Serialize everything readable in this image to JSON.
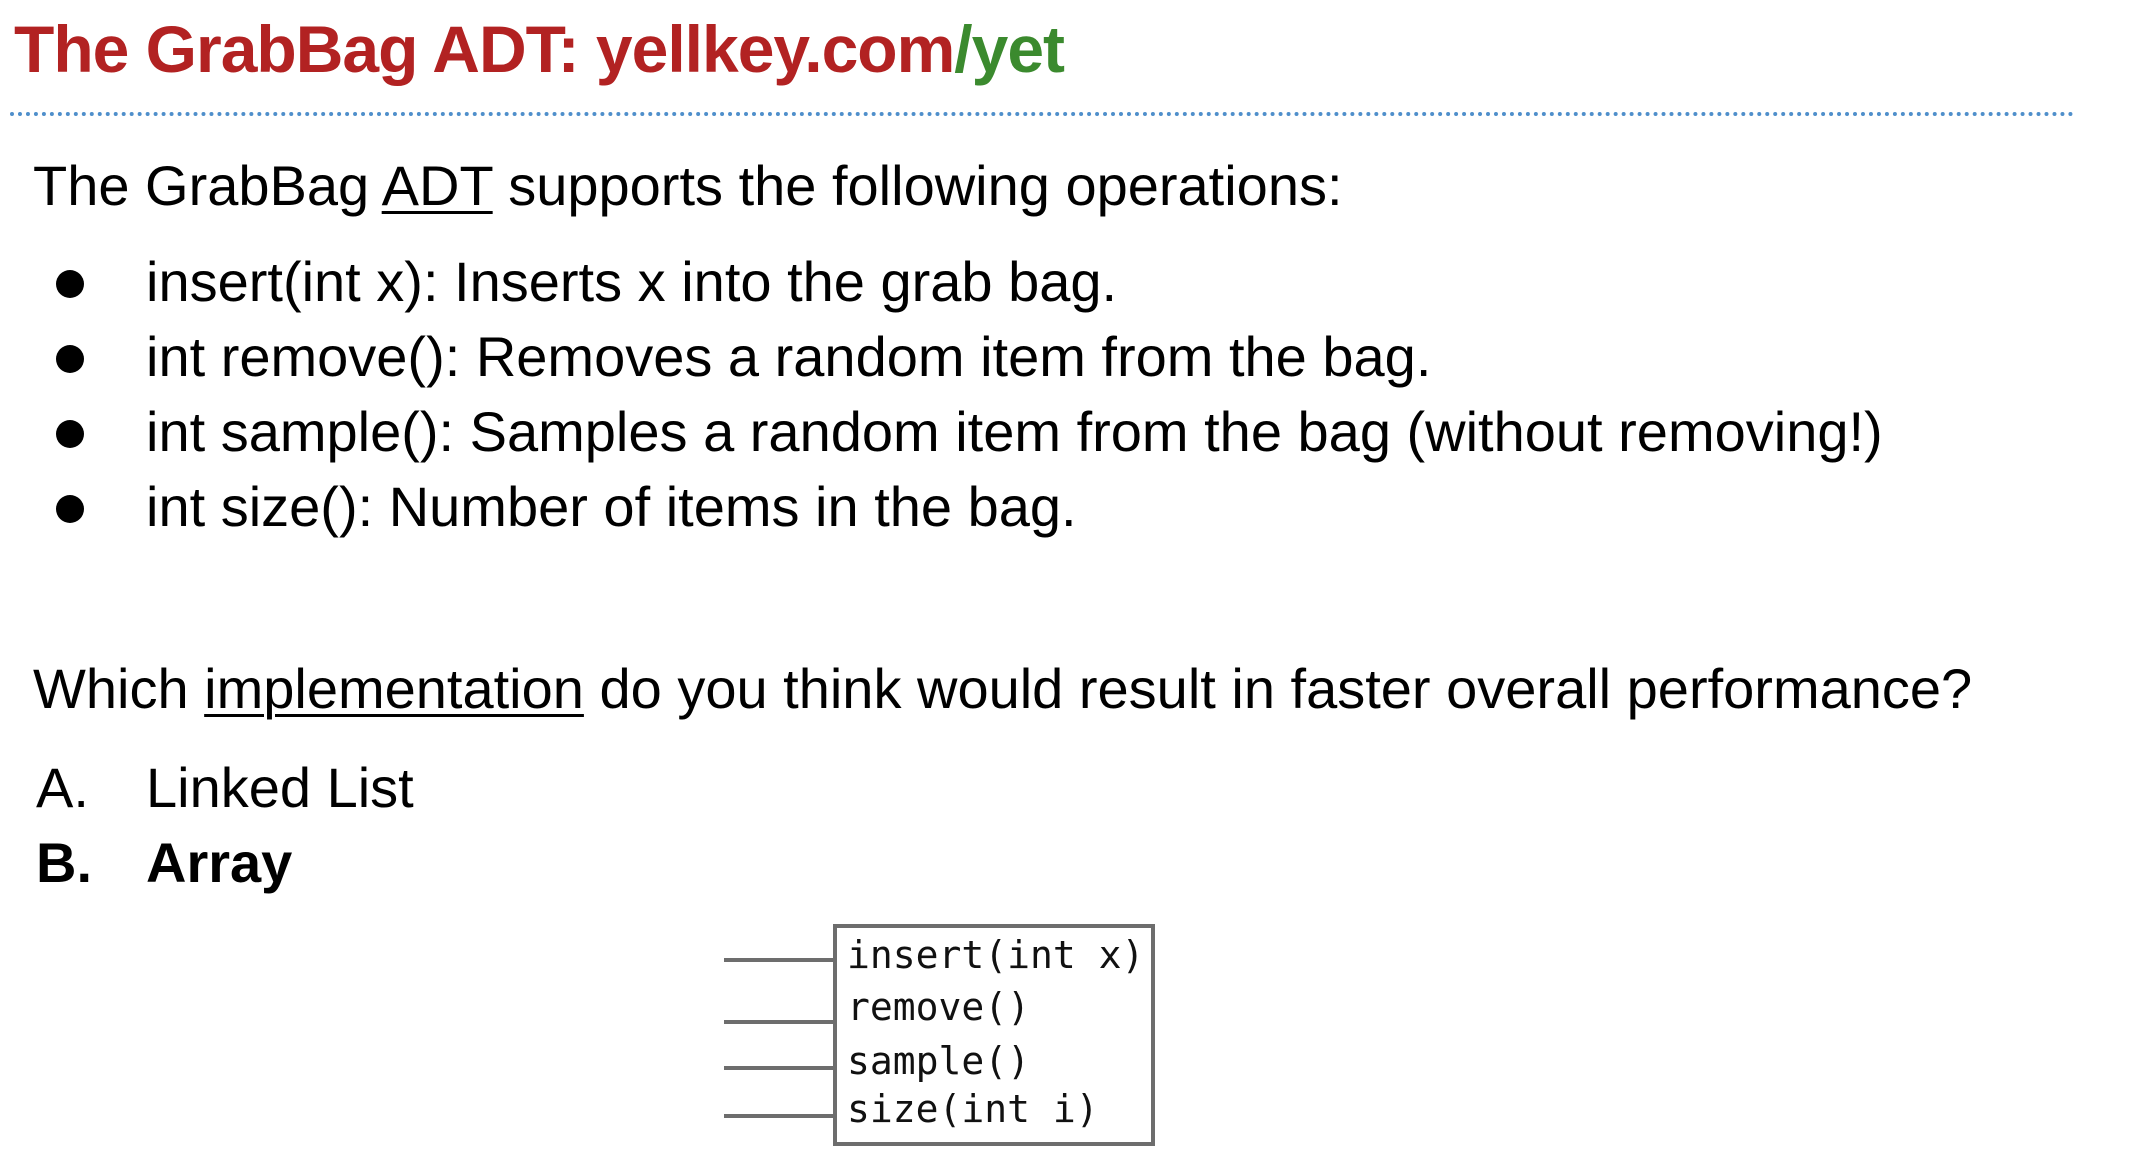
{
  "title": {
    "main": "The GrabBag ADT: yellkey.com",
    "slash": "/",
    "code": "yet",
    "accent_color": "#b22222",
    "code_color": "#3b8a2e"
  },
  "intro": {
    "prefix": "The GrabBag ",
    "underlined": "ADT",
    "suffix": " supports the following operations:"
  },
  "operations": [
    "insert(int x): Inserts x into the grab bag.",
    "int remove(): Removes a random item from the bag.",
    "int sample(): Samples a random item from the bag (without removing!)",
    "int size(): Number of items in the bag."
  ],
  "question": {
    "prefix": "Which ",
    "underlined": "implementation",
    "suffix": " do you think would result in faster overall performance?"
  },
  "choices": [
    {
      "letter": "A.",
      "text": "Linked List"
    },
    {
      "letter": "B.",
      "text": "Array"
    }
  ],
  "interface_box": {
    "methods": [
      "insert(int x)",
      "remove()",
      "sample()",
      "size(int i)"
    ]
  }
}
